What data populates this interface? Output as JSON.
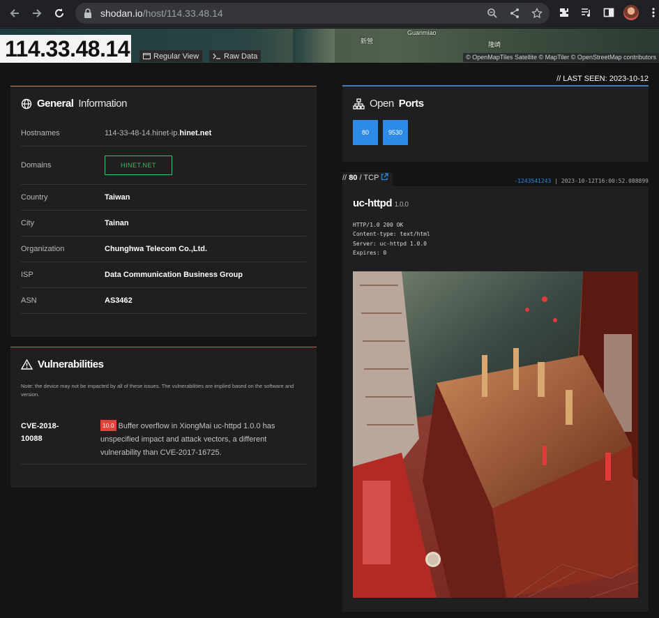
{
  "browser": {
    "url_host": "shodan.io",
    "url_path": "/host/114.33.48.14"
  },
  "map": {
    "labels": [
      "Guanmiao",
      "新營",
      "隆崎"
    ],
    "attribution": "© OpenMapTiles Satellite   © MapTiler © OpenStreetMap contributors"
  },
  "header": {
    "ip": "114.33.48.14",
    "regular_view": "Regular View",
    "raw_data": "Raw Data",
    "last_seen": "// LAST SEEN: 2023-10-12"
  },
  "general": {
    "title_bold": "General",
    "title_light": "Information",
    "rows": [
      {
        "key": "Hostnames",
        "value_prefix": "114-33-48-14.hinet-ip.",
        "value_bold": "hinet.net"
      },
      {
        "key": "Domains",
        "badge": "HINET.NET"
      },
      {
        "key": "Country",
        "value": "Taiwan"
      },
      {
        "key": "City",
        "value": "Tainan"
      },
      {
        "key": "Organization",
        "value": "Chunghwa Telecom Co.,Ltd."
      },
      {
        "key": "ISP",
        "value": "Data Communication Business Group"
      },
      {
        "key": "ASN",
        "value": "AS3462"
      }
    ]
  },
  "vulns": {
    "title": "Vulnerabilities",
    "note": "Note: the device may not be impacted by all of these issues. The vulnerabilities are implied based on the software and version.",
    "items": [
      {
        "cve_line1": "CVE-2018-",
        "cve_line2": "10088",
        "score": "10.0",
        "desc": "Buffer overflow in XiongMai uc-httpd 1.0.0 has unspecified impact and attack vectors, a different vulnerability than CVE-2017-16725."
      }
    ]
  },
  "ports": {
    "title_light": "Open",
    "title_bold": "Ports",
    "list": [
      "80",
      "9530"
    ]
  },
  "service": {
    "prefix": "//",
    "port": "80",
    "proto": "/ TCP",
    "hash": "-1243541243",
    "sep": "|",
    "timestamp": "2023-10-12T16:00:52.088899",
    "product": "uc-httpd",
    "version": "1.0.0",
    "banner": "HTTP/1.0 200 OK\nContent-type: text/html\nServer: uc-httpd 1.0.0\nExpires: 0"
  }
}
